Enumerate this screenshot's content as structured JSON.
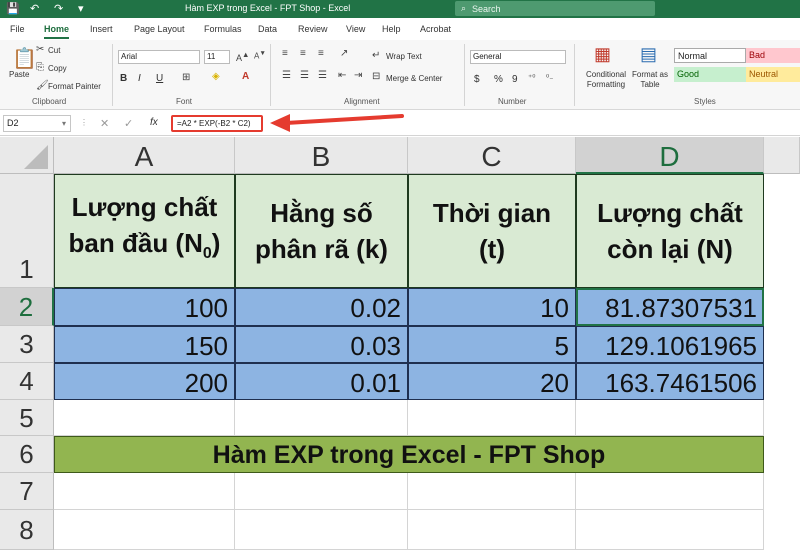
{
  "titlebar": {
    "title": "Hàm EXP trong Excel - FPT Shop - Excel",
    "search_placeholder": "Search"
  },
  "tabs": [
    "File",
    "Home",
    "Insert",
    "Page Layout",
    "Formulas",
    "Data",
    "Review",
    "View",
    "Help",
    "Acrobat"
  ],
  "active_tab": "Home",
  "ribbon": {
    "clipboard": {
      "paste": "Paste",
      "cut": "Cut",
      "copy": "Copy",
      "format_painter": "Format Painter",
      "label": "Clipboard"
    },
    "font": {
      "name": "Arial",
      "size": "11",
      "bold": "B",
      "italic": "I",
      "underline": "U",
      "label": "Font"
    },
    "alignment": {
      "wrap_text": "Wrap Text",
      "merge_center": "Merge & Center",
      "label": "Alignment"
    },
    "number": {
      "format": "General",
      "currency": "$",
      "percent": "%",
      "comma": "9",
      "label": "Number"
    },
    "styles": {
      "conditional": "Conditional Formatting",
      "format_table": "Format as Table",
      "normal": "Normal",
      "bad": "Bad",
      "good": "Good",
      "neutral": "Neutral",
      "label": "Styles"
    }
  },
  "formula_bar": {
    "name_box": "D2",
    "fx": "fx",
    "formula": "=A2 * EXP(-B2 * C2)"
  },
  "sheet": {
    "columns": [
      "A",
      "B",
      "C",
      "D"
    ],
    "rows": [
      "1",
      "2",
      "3",
      "4",
      "5",
      "6",
      "7",
      "8"
    ],
    "headers": {
      "a_line1": "Lượng chất",
      "a_line2": "ban đầu (N",
      "a_sub": "0",
      "a_line2_end": ")",
      "b_line1": "Hằng số",
      "b_line2": "phân rã (k)",
      "c_line1": "Thời gian",
      "c_line2": "(t)",
      "d_line1": "Lượng chất",
      "d_line2": "còn lại (N)"
    },
    "data": [
      [
        "100",
        "0.02",
        "10",
        "81.87307531"
      ],
      [
        "150",
        "0.03",
        "5",
        "129.1061965"
      ],
      [
        "200",
        "0.01",
        "20",
        "163.7461506"
      ]
    ],
    "banner": "Hàm EXP trong Excel - FPT Shop"
  }
}
